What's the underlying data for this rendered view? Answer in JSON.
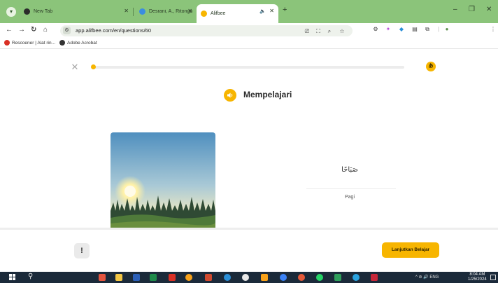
{
  "browser": {
    "tabs": [
      {
        "title": "New Tab",
        "active": false,
        "favicon_color": "#2b2b2b"
      },
      {
        "title": "Desrani, A., Ritonga, A. W., & Fi",
        "active": false,
        "favicon_color": "#3b8de0"
      },
      {
        "title": "Alifbee",
        "active": true,
        "favicon_color": "#f7b500"
      }
    ],
    "tab_menu_icon": "chevron-down-icon",
    "new_tab_label": "+",
    "audio_icon": "🔈",
    "close_glyph": "✕",
    "url": "app.alifbee.com/en/questions/60",
    "bookmarks": [
      {
        "label": "Rescoener | Alat rin...",
        "color": "#d93025"
      },
      {
        "label": "Adobe Acrobat",
        "color": "#333333"
      }
    ]
  },
  "lesson": {
    "exit_glyph": "✕",
    "progress_fraction": 0.01,
    "title": "Mempelajari",
    "arabic_word": "صَبَاحًا",
    "translation": "Pagi",
    "report_glyph": "!",
    "continue_label": "Lanjutkan Belajar"
  },
  "taskbar": {
    "search_glyph": "⚲",
    "tray_text": "^  ⊘  🔊  ENG",
    "time": "8:04 AM",
    "date": "1/25/2024"
  },
  "colors": {
    "accent": "#f7b500",
    "tabbar": "#8bc47a",
    "taskbar": "#1b2a3a"
  }
}
